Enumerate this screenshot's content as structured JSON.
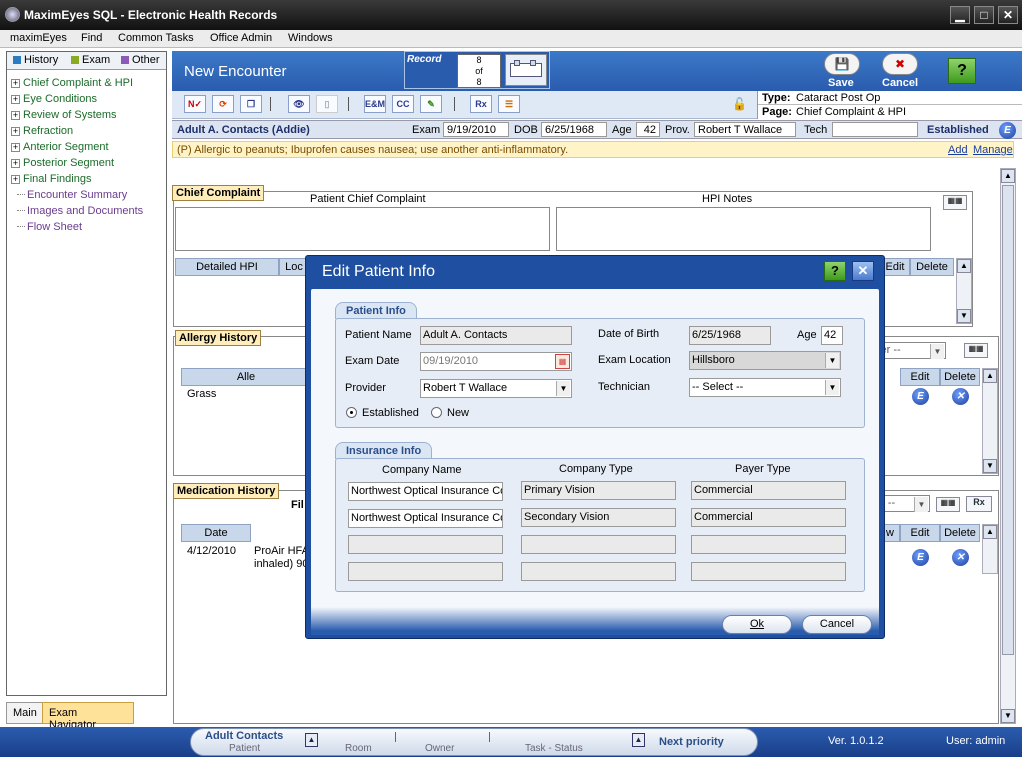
{
  "window": {
    "title": "MaximEyes SQL - Electronic Health Records"
  },
  "menu": [
    "maximEyes",
    "Find",
    "Common Tasks",
    "Office Admin",
    "Windows"
  ],
  "nav": {
    "tabs": [
      {
        "label": "History",
        "color": "#2a7bbf"
      },
      {
        "label": "Exam",
        "color": "#8aaa22"
      },
      {
        "label": "Other",
        "color": "#8a5ab8"
      }
    ],
    "tree": [
      "Chief Complaint & HPI",
      "Eye Conditions",
      "Review of Systems",
      "Refraction",
      "Anterior Segment",
      "Posterior Segment",
      "Final Findings"
    ],
    "leaves": [
      "Encounter Summary",
      "Images and Documents",
      "Flow Sheet"
    ],
    "bottom_tabs": [
      "Main",
      "Exam Navigator"
    ]
  },
  "header": {
    "title": "New Encounter",
    "record_label": "Record",
    "record_current": "8",
    "record_of": "of",
    "record_total": "8",
    "save": "Save",
    "cancel": "Cancel"
  },
  "toolbar": {
    "em": "E&M",
    "cc": "CC",
    "rx": "Rx"
  },
  "typepage": {
    "type_label": "Type:",
    "type_value": "Cataract Post Op",
    "page_label": "Page:",
    "page_value": "Chief Complaint & HPI"
  },
  "patient": {
    "name": "Adult A. Contacts (Addie)",
    "exam_label": "Exam",
    "exam": "9/19/2010",
    "dob_label": "DOB",
    "dob": "6/25/1968",
    "age_label": "Age",
    "age": "42",
    "prov_label": "Prov.",
    "prov": "Robert T Wallace",
    "tech_label": "Tech",
    "tech": "",
    "status": "Established"
  },
  "alert": {
    "text": "(P) Allergic to peanuts; Ibuprofen causes nausea; use another anti-inflammatory.",
    "add": "Add",
    "manage": "Manage"
  },
  "chief": {
    "title": "Chief Complaint",
    "col1": "Patient Chief Complaint",
    "col2": "HPI Notes",
    "grid_h1": "Detailed HPI",
    "grid_h2": "Loc",
    "edit": "Edit",
    "delete": "Delete"
  },
  "allergy": {
    "title": "Allergy History",
    "col": "Alle",
    "row1": "Grass",
    "filter": "ser --",
    "edit": "Edit",
    "delete": "Delete"
  },
  "medication": {
    "title": "Medication History",
    "filter_label": "Fil",
    "h_date": "Date",
    "row_date": "4/12/2010",
    "row_drug": "ProAir HFA",
    "row_drug2": "inhaled) 90",
    "filter": "er --",
    "w": "w",
    "edit": "Edit",
    "delete": "Delete",
    "rx": "Rx"
  },
  "status": {
    "patient_name": "Adult Contacts",
    "patient_label": "Patient",
    "room": "Room",
    "owner": "Owner",
    "task": "Task - Status",
    "next": "Next priority",
    "version": "Ver. 1.0.1.2",
    "user": "User: admin"
  },
  "dialog": {
    "title": "Edit Patient Info",
    "patient_group": "Patient Info",
    "name_label": "Patient Name",
    "name": "Adult A. Contacts",
    "dob_label": "Date of Birth",
    "dob": "6/25/1968",
    "age_label": "Age",
    "age": "42",
    "exam_date_label": "Exam Date",
    "exam_date": "09/19/2010",
    "location_label": "Exam Location",
    "location": "Hillsboro",
    "provider_label": "Provider",
    "provider": "Robert T Wallace",
    "tech_label": "Technician",
    "tech": "-- Select --",
    "established": "Established",
    "new": "New",
    "insurance_group": "Insurance Info",
    "h_company": "Company Name",
    "h_type": "Company Type",
    "h_payer": "Payer Type",
    "rows": [
      {
        "company": "Northwest Optical Insurance Co",
        "type": "Primary Vision",
        "payer": "Commercial"
      },
      {
        "company": "Northwest Optical Insurance Co",
        "type": "Secondary Vision",
        "payer": "Commercial"
      },
      {
        "company": "",
        "type": "",
        "payer": ""
      },
      {
        "company": "",
        "type": "",
        "payer": ""
      }
    ],
    "ok": "Ok",
    "cancel": "Cancel"
  }
}
